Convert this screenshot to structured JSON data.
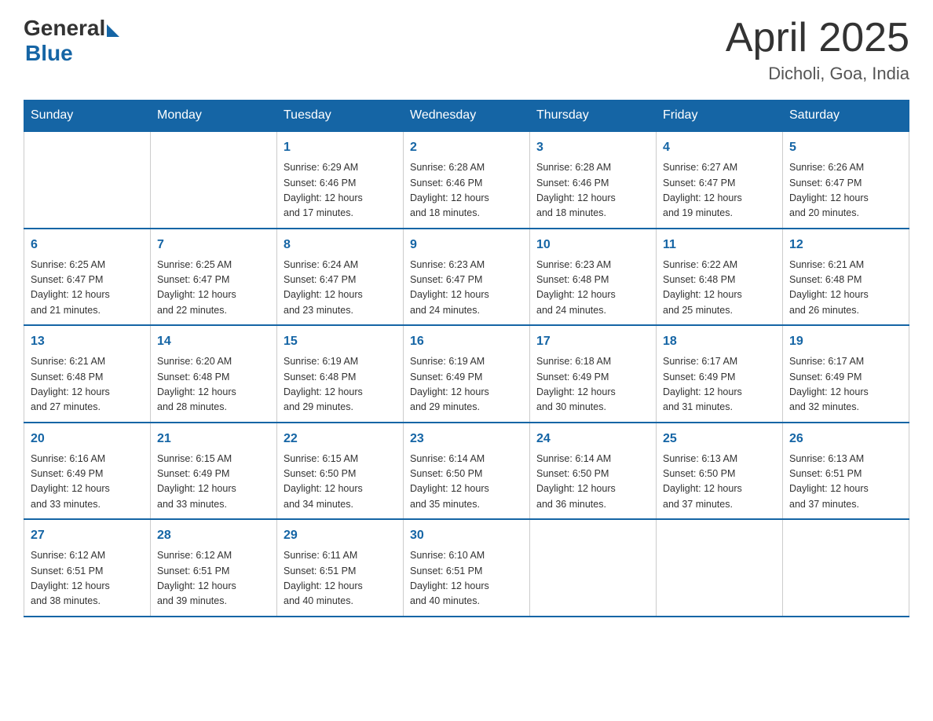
{
  "header": {
    "logo_general": "General",
    "logo_blue": "Blue",
    "month_year": "April 2025",
    "location": "Dicholi, Goa, India"
  },
  "days_of_week": [
    "Sunday",
    "Monday",
    "Tuesday",
    "Wednesday",
    "Thursday",
    "Friday",
    "Saturday"
  ],
  "weeks": [
    [
      {
        "day": "",
        "info": ""
      },
      {
        "day": "",
        "info": ""
      },
      {
        "day": "1",
        "info": "Sunrise: 6:29 AM\nSunset: 6:46 PM\nDaylight: 12 hours\nand 17 minutes."
      },
      {
        "day": "2",
        "info": "Sunrise: 6:28 AM\nSunset: 6:46 PM\nDaylight: 12 hours\nand 18 minutes."
      },
      {
        "day": "3",
        "info": "Sunrise: 6:28 AM\nSunset: 6:46 PM\nDaylight: 12 hours\nand 18 minutes."
      },
      {
        "day": "4",
        "info": "Sunrise: 6:27 AM\nSunset: 6:47 PM\nDaylight: 12 hours\nand 19 minutes."
      },
      {
        "day": "5",
        "info": "Sunrise: 6:26 AM\nSunset: 6:47 PM\nDaylight: 12 hours\nand 20 minutes."
      }
    ],
    [
      {
        "day": "6",
        "info": "Sunrise: 6:25 AM\nSunset: 6:47 PM\nDaylight: 12 hours\nand 21 minutes."
      },
      {
        "day": "7",
        "info": "Sunrise: 6:25 AM\nSunset: 6:47 PM\nDaylight: 12 hours\nand 22 minutes."
      },
      {
        "day": "8",
        "info": "Sunrise: 6:24 AM\nSunset: 6:47 PM\nDaylight: 12 hours\nand 23 minutes."
      },
      {
        "day": "9",
        "info": "Sunrise: 6:23 AM\nSunset: 6:47 PM\nDaylight: 12 hours\nand 24 minutes."
      },
      {
        "day": "10",
        "info": "Sunrise: 6:23 AM\nSunset: 6:48 PM\nDaylight: 12 hours\nand 24 minutes."
      },
      {
        "day": "11",
        "info": "Sunrise: 6:22 AM\nSunset: 6:48 PM\nDaylight: 12 hours\nand 25 minutes."
      },
      {
        "day": "12",
        "info": "Sunrise: 6:21 AM\nSunset: 6:48 PM\nDaylight: 12 hours\nand 26 minutes."
      }
    ],
    [
      {
        "day": "13",
        "info": "Sunrise: 6:21 AM\nSunset: 6:48 PM\nDaylight: 12 hours\nand 27 minutes."
      },
      {
        "day": "14",
        "info": "Sunrise: 6:20 AM\nSunset: 6:48 PM\nDaylight: 12 hours\nand 28 minutes."
      },
      {
        "day": "15",
        "info": "Sunrise: 6:19 AM\nSunset: 6:48 PM\nDaylight: 12 hours\nand 29 minutes."
      },
      {
        "day": "16",
        "info": "Sunrise: 6:19 AM\nSunset: 6:49 PM\nDaylight: 12 hours\nand 29 minutes."
      },
      {
        "day": "17",
        "info": "Sunrise: 6:18 AM\nSunset: 6:49 PM\nDaylight: 12 hours\nand 30 minutes."
      },
      {
        "day": "18",
        "info": "Sunrise: 6:17 AM\nSunset: 6:49 PM\nDaylight: 12 hours\nand 31 minutes."
      },
      {
        "day": "19",
        "info": "Sunrise: 6:17 AM\nSunset: 6:49 PM\nDaylight: 12 hours\nand 32 minutes."
      }
    ],
    [
      {
        "day": "20",
        "info": "Sunrise: 6:16 AM\nSunset: 6:49 PM\nDaylight: 12 hours\nand 33 minutes."
      },
      {
        "day": "21",
        "info": "Sunrise: 6:15 AM\nSunset: 6:49 PM\nDaylight: 12 hours\nand 33 minutes."
      },
      {
        "day": "22",
        "info": "Sunrise: 6:15 AM\nSunset: 6:50 PM\nDaylight: 12 hours\nand 34 minutes."
      },
      {
        "day": "23",
        "info": "Sunrise: 6:14 AM\nSunset: 6:50 PM\nDaylight: 12 hours\nand 35 minutes."
      },
      {
        "day": "24",
        "info": "Sunrise: 6:14 AM\nSunset: 6:50 PM\nDaylight: 12 hours\nand 36 minutes."
      },
      {
        "day": "25",
        "info": "Sunrise: 6:13 AM\nSunset: 6:50 PM\nDaylight: 12 hours\nand 37 minutes."
      },
      {
        "day": "26",
        "info": "Sunrise: 6:13 AM\nSunset: 6:51 PM\nDaylight: 12 hours\nand 37 minutes."
      }
    ],
    [
      {
        "day": "27",
        "info": "Sunrise: 6:12 AM\nSunset: 6:51 PM\nDaylight: 12 hours\nand 38 minutes."
      },
      {
        "day": "28",
        "info": "Sunrise: 6:12 AM\nSunset: 6:51 PM\nDaylight: 12 hours\nand 39 minutes."
      },
      {
        "day": "29",
        "info": "Sunrise: 6:11 AM\nSunset: 6:51 PM\nDaylight: 12 hours\nand 40 minutes."
      },
      {
        "day": "30",
        "info": "Sunrise: 6:10 AM\nSunset: 6:51 PM\nDaylight: 12 hours\nand 40 minutes."
      },
      {
        "day": "",
        "info": ""
      },
      {
        "day": "",
        "info": ""
      },
      {
        "day": "",
        "info": ""
      }
    ]
  ]
}
